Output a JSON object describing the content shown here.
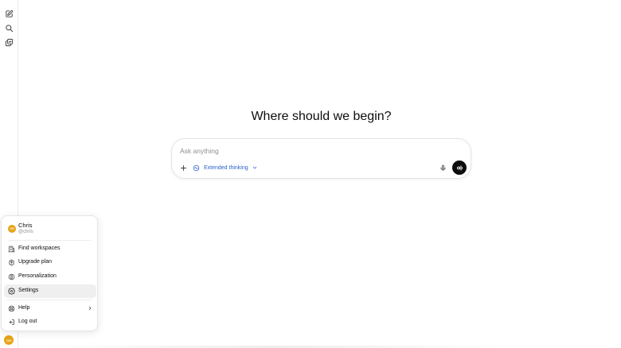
{
  "rail": {
    "icons": [
      "new-chat-icon",
      "search-icon",
      "library-icon"
    ],
    "avatar_initials": "CH"
  },
  "main": {
    "headline": "Where should we begin?"
  },
  "composer": {
    "placeholder": "Ask anything",
    "value": "",
    "mode_label": "Extended thinking"
  },
  "account_menu": {
    "user_name": "Chris",
    "user_handle": "@chris",
    "avatar_initials": "CH",
    "items": [
      {
        "label": "Find workspaces",
        "icon": "building-icon"
      },
      {
        "label": "Upgrade plan",
        "icon": "upgrade-icon"
      },
      {
        "label": "Personalization",
        "icon": "personalization-icon"
      },
      {
        "label": "Settings",
        "icon": "gear-icon"
      },
      {
        "label": "Help",
        "icon": "help-icon"
      },
      {
        "label": "Log out",
        "icon": "logout-icon"
      }
    ],
    "active_item": "Settings"
  },
  "colors": {
    "accent_blue": "#2b63c8",
    "avatar": "#e8a317",
    "active_item_bg": "#efefef",
    "send_button": "#0d0d0d"
  }
}
